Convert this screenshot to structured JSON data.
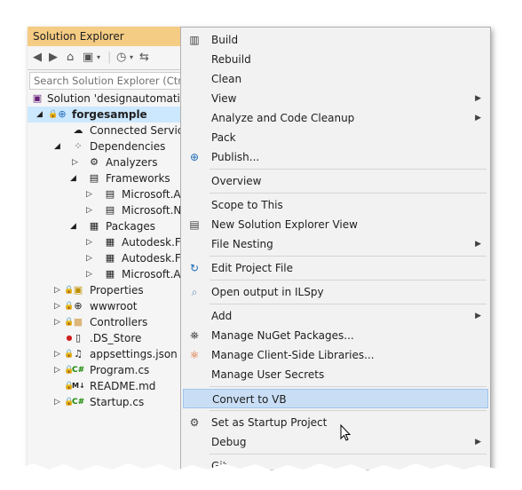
{
  "solution_explorer": {
    "title": "Solution Explorer",
    "search_placeholder": "Search Solution Explorer (Ctrl+;)",
    "tree": [
      {
        "label": "Solution 'designautomatio",
        "icon": "solution-icon"
      },
      {
        "label": "forgesample",
        "icon": "web-project-icon",
        "selected": true
      },
      {
        "label": "Connected Services",
        "icon": "connected-services-icon"
      },
      {
        "label": "Dependencies",
        "icon": "dependencies-icon"
      },
      {
        "label": "Analyzers",
        "icon": "analyzers-icon"
      },
      {
        "label": "Frameworks",
        "icon": "frameworks-icon"
      },
      {
        "label": "Microsoft.As",
        "icon": "framework-ref-icon"
      },
      {
        "label": "Microsoft.NE",
        "icon": "framework-ref-icon"
      },
      {
        "label": "Packages",
        "icon": "packages-icon"
      },
      {
        "label": "Autodesk.Fo",
        "icon": "package-icon"
      },
      {
        "label": "Autodesk.Fo",
        "icon": "package-icon"
      },
      {
        "label": "Microsoft.As",
        "icon": "package-icon"
      },
      {
        "label": "Properties",
        "icon": "properties-icon"
      },
      {
        "label": "wwwroot",
        "icon": "globe-icon"
      },
      {
        "label": "Controllers",
        "icon": "folder-icon"
      },
      {
        "label": ".DS_Store",
        "icon": "file-icon"
      },
      {
        "label": "appsettings.json",
        "icon": "json-icon"
      },
      {
        "label": "Program.cs",
        "icon": "csharp-icon"
      },
      {
        "label": "README.md",
        "icon": "markdown-icon"
      },
      {
        "label": "Startup.cs",
        "icon": "csharp-icon"
      }
    ]
  },
  "context_menu": {
    "items": [
      {
        "label": "Build",
        "icon": "build-icon"
      },
      {
        "label": "Rebuild"
      },
      {
        "label": "Clean"
      },
      {
        "label": "View",
        "submenu": true
      },
      {
        "label": "Analyze and Code Cleanup",
        "submenu": true
      },
      {
        "label": "Pack"
      },
      {
        "label": "Publish...",
        "icon": "publish-globe-icon"
      },
      {
        "label": "Overview"
      },
      {
        "label": "Scope to This"
      },
      {
        "label": "New Solution Explorer View",
        "icon": "new-view-icon"
      },
      {
        "label": "File Nesting",
        "submenu": true
      },
      {
        "label": "Edit Project File",
        "icon": "edit-project-icon"
      },
      {
        "label": "Open output in ILSpy",
        "icon": "ilspy-icon"
      },
      {
        "label": "Add",
        "submenu": true
      },
      {
        "label": "Manage NuGet Packages...",
        "icon": "nuget-icon"
      },
      {
        "label": "Manage Client-Side Libraries...",
        "icon": "libman-icon"
      },
      {
        "label": "Manage User Secrets"
      },
      {
        "label": "Convert to VB",
        "highlighted": true
      },
      {
        "label": "Set as Startup Project",
        "icon": "settings-gear-icon"
      },
      {
        "label": "Debug",
        "submenu": true
      },
      {
        "label": "Git"
      }
    ]
  },
  "colors": {
    "title_bar": "#f5cc84",
    "selection": "#cce8ff",
    "menu_highlight": "#c9def5",
    "menu_background": "#f2f2f2"
  }
}
